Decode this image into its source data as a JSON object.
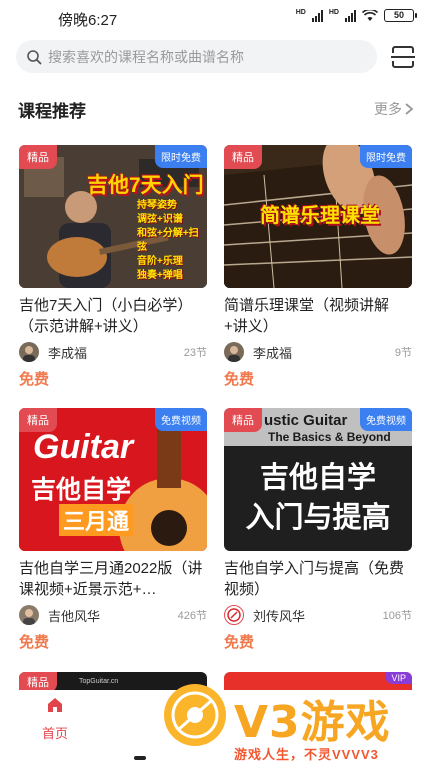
{
  "status_bar": {
    "time": "傍晚6:27",
    "network_1": "HD",
    "network_2": "HD",
    "battery": "50"
  },
  "search": {
    "placeholder": "搜索喜欢的课程名称或曲谱名称"
  },
  "section": {
    "title": "课程推荐",
    "more_label": "更多"
  },
  "courses": [
    {
      "badge": "精品",
      "corner_tag": "限时免费",
      "title": "吉他7天入门（小白必学）（示范讲解+讲义）",
      "author": "李成福",
      "lessons": "23节",
      "price": "免费",
      "cover": {
        "headline": "吉他7天入门",
        "lines": [
          "持琴姿势",
          "调弦+识谱",
          "和弦+分解+扫弦",
          "音阶+乐理",
          "独奏+弹唱"
        ]
      }
    },
    {
      "badge": "精品",
      "corner_tag": "限时免费",
      "title": "简谱乐理课堂（视频讲解+讲义）",
      "author": "李成福",
      "lessons": "9节",
      "price": "免费",
      "cover": {
        "headline": "简谱乐理课堂"
      }
    },
    {
      "badge": "精品",
      "corner_tag": "免费视频",
      "title": "吉他自学三月通2022版（讲课视频+近景示范+…",
      "author": "吉他风华",
      "lessons": "426节",
      "price": "免费",
      "cover": {
        "headline_en": "Guitar",
        "headline": "吉他自学",
        "sub": "三月通"
      }
    },
    {
      "badge": "精品",
      "corner_tag": "免费视频",
      "title": "吉他自学入门与提高（免费视频）",
      "author": "刘传风华",
      "lessons": "106节",
      "price": "免费",
      "cover": {
        "headline_en": "ustic Guitar",
        "headline_en_2": "The Basics & Beyond",
        "headline": "吉他自学",
        "sub": "入门与提高"
      }
    }
  ],
  "peek": {
    "badge": "精品",
    "corner_tag": "VIP",
    "brand": "TopGuitar.cn"
  },
  "tabbar": {
    "home_label": "首页"
  },
  "watermark": {
    "logo_text": "V3游戏",
    "slogan": "游戏人生，不灵VVVV3"
  },
  "colors": {
    "accent_red": "#e2444c",
    "price_orange": "#f07a4e",
    "tag_blue": "#3b7ff0",
    "watermark_yellow": "#f7a623"
  }
}
